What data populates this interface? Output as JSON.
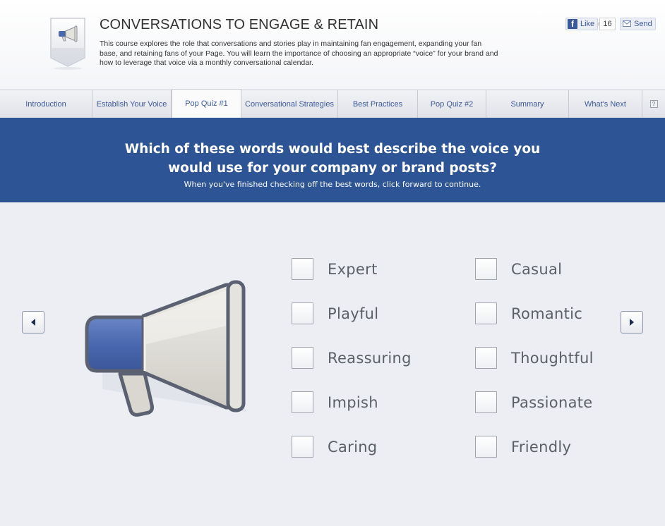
{
  "header": {
    "title": "CONVERSATIONS TO ENGAGE & RETAIN",
    "description": "This course explores the role that conversations and stories play in maintaining fan engagement, expanding your fan base, and retaining fans of your Page. You will learn the importance of choosing an appropriate “voice” for your brand and how to leverage that voice via a monthly conversational calendar.",
    "like_label": "Like",
    "like_count": "16",
    "send_label": "Send",
    "fb_logo": "f"
  },
  "tabs": [
    {
      "label": "Introduction",
      "active": false
    },
    {
      "label": "Establish Your Voice",
      "active": false
    },
    {
      "label": "Pop Quiz #1",
      "active": true
    },
    {
      "label": "Conversational Strategies",
      "active": false
    },
    {
      "label": "Best Practices",
      "active": false
    },
    {
      "label": "Pop Quiz #2",
      "active": false
    },
    {
      "label": "Summary",
      "active": false
    },
    {
      "label": "What's Next",
      "active": false
    }
  ],
  "help_glyph": "?",
  "quiz": {
    "question_line1": "Which of these words would best describe the voice you",
    "question_line2": "would use for your company or brand posts?",
    "instructions": "When you've finished checking off the best words, click forward to continue."
  },
  "choices_left": [
    "Expert",
    "Playful",
    "Reassuring",
    "Impish",
    "Caring"
  ],
  "choices_right": [
    "Casual",
    "Romantic",
    "Thoughtful",
    "Passionate",
    "Friendly"
  ],
  "colors": {
    "banner": "#2d5495",
    "accent": "#3b5998",
    "megaphone_blue": "#4a68b0"
  },
  "icons": {
    "badge": "megaphone-badge-icon",
    "hero": "megaphone-icon",
    "prev": "arrow-left-icon",
    "next": "arrow-right-icon"
  }
}
